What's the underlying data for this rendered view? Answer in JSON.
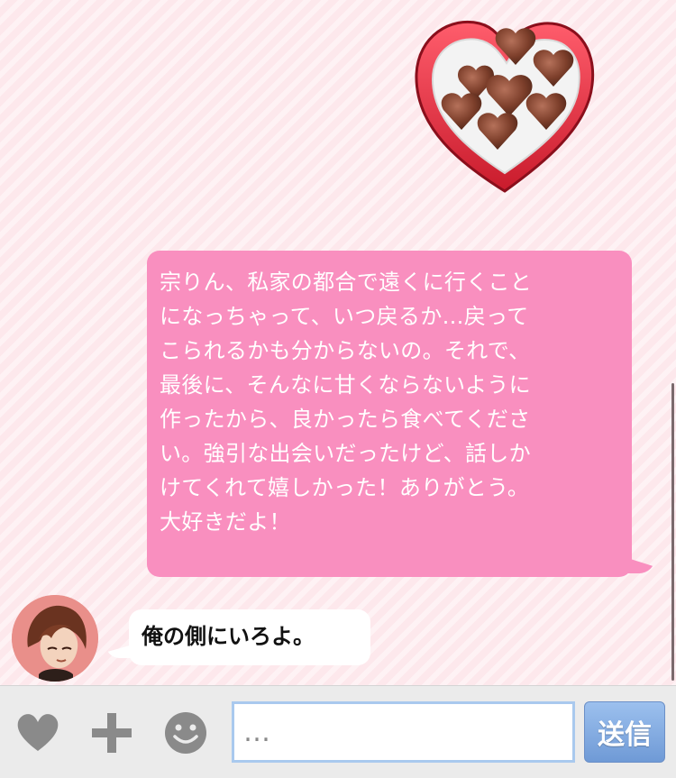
{
  "messages": {
    "outgoing_sticker": {
      "icon": "heart-chocolate-box-sticker"
    },
    "outgoing_text": {
      "lines": [
        "宗りん、私家の都合で遠くに行くこと",
        "になっちゃって、いつ戻るか…戻って",
        "こられるかも分からないの。それで、",
        "最後に、そんなに甘くならないように",
        "作ったから、良かったら食べてくださ",
        "い。強引な出会いだったけど、話しか",
        "けてくれて嬉しかった！ありがとう。",
        "大好きだよ！"
      ]
    },
    "incoming": {
      "avatar": "character-avatar",
      "text": "俺の側にいろよ。"
    }
  },
  "input_bar": {
    "heart_icon": "heart-icon",
    "plus_icon": "plus-icon",
    "emoji_icon": "smiley-icon",
    "placeholder": "…",
    "send_label": "送信"
  },
  "colors": {
    "background": "#fde8ec",
    "outgoing_bubble": "#f98fbf",
    "incoming_bubble": "#ffffff",
    "send_button": "#7fa7de",
    "input_border": "#a9c9ee"
  }
}
